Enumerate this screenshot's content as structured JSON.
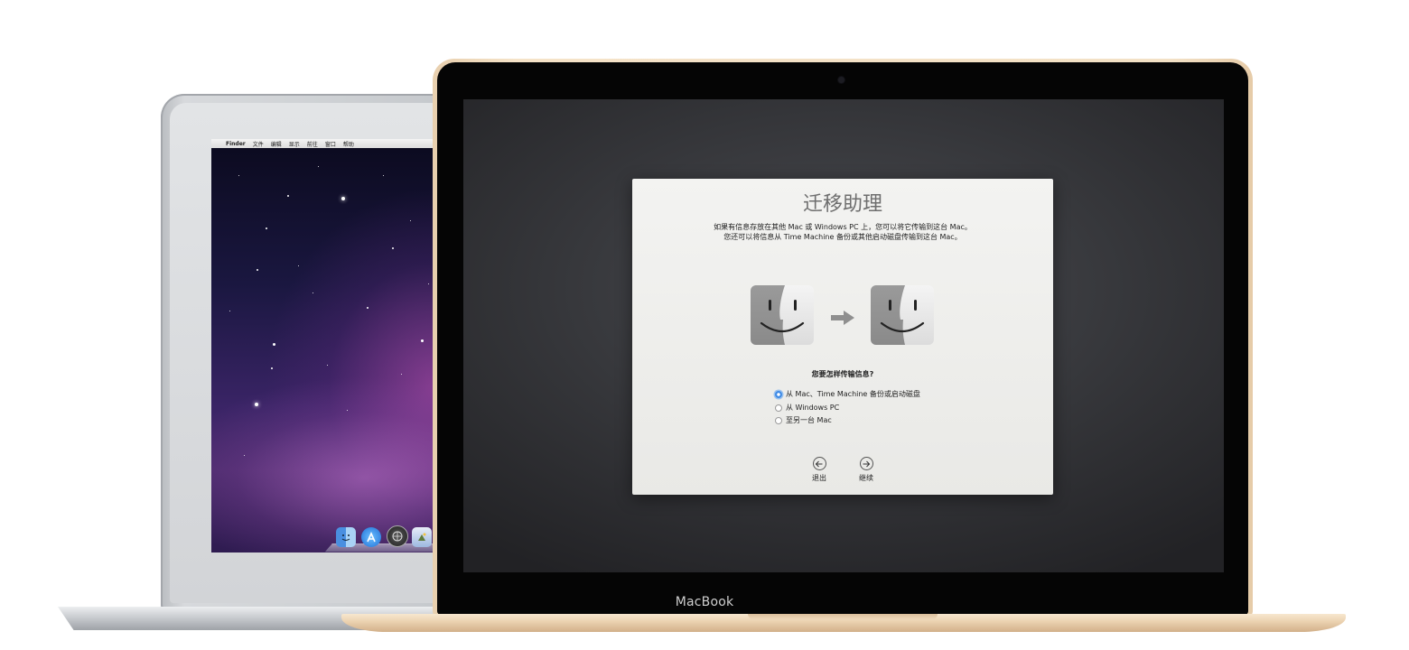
{
  "air": {
    "menubar": {
      "apple": "",
      "app": "Finder",
      "menus": [
        "文件",
        "编辑",
        "显示",
        "前往",
        "窗口",
        "帮助"
      ]
    },
    "dock_icons": [
      "finder-icon",
      "app-store-icon",
      "launchpad-icon",
      "preview-icon"
    ]
  },
  "macbook": {
    "brand": "MacBook"
  },
  "window": {
    "title": "迁移助理",
    "description_line1": "如果有信息存放在其他 Mac 或 Windows PC 上，您可以将它传输到这台 Mac。",
    "description_line2": "您还可以将信息从 Time Machine 备份或其他启动磁盘传输到这台 Mac。",
    "question": "您要怎样传输信息?",
    "options": [
      {
        "label": "从 Mac、Time Machine 备份或启动磁盘",
        "selected": true
      },
      {
        "label": "从 Windows PC",
        "selected": false
      },
      {
        "label": "至另一台 Mac",
        "selected": false
      }
    ],
    "quit_label": "退出",
    "continue_label": "继续"
  },
  "colors": {
    "radio_accent": "#3d8ae6",
    "gold": "#f3e1c6",
    "silver": "#cfd2d5"
  }
}
